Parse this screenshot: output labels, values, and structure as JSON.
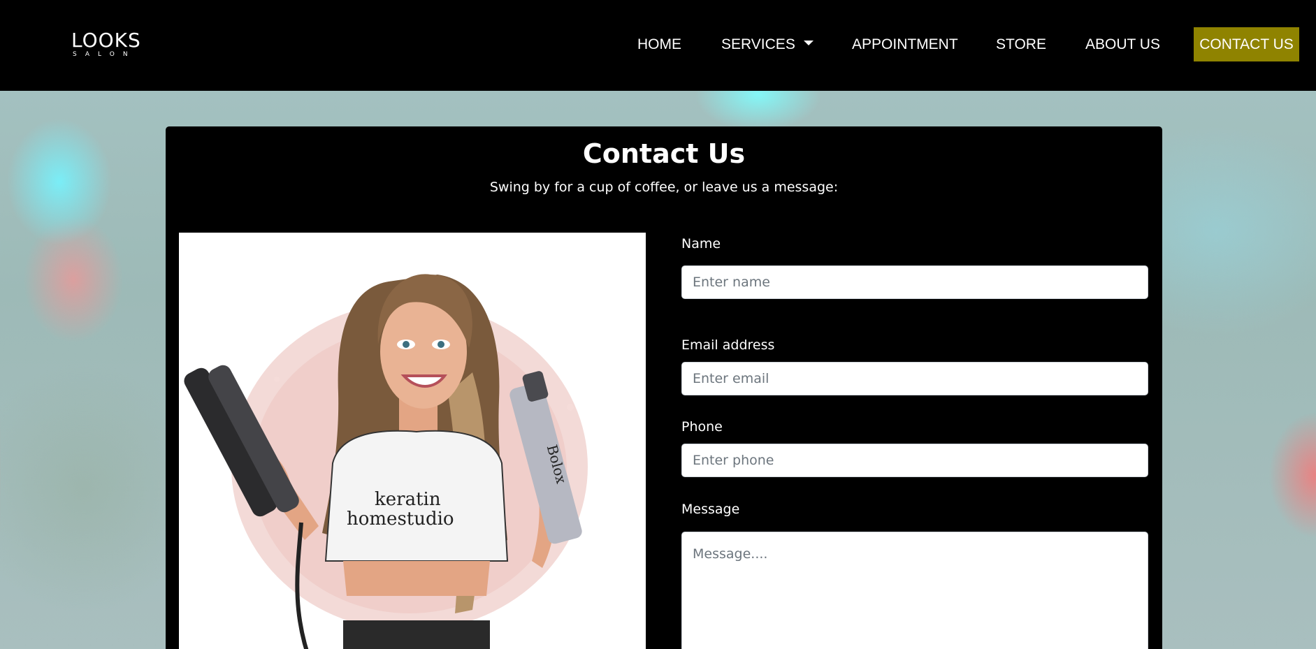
{
  "brand": {
    "name": "LOOKS",
    "tagline": "SALON"
  },
  "nav": {
    "items": [
      {
        "label": "HOME"
      },
      {
        "label": "SERVICES"
      },
      {
        "label": "APPOINTMENT"
      },
      {
        "label": "STORE"
      },
      {
        "label": "ABOUT US"
      }
    ],
    "cta": {
      "label": "CONTACT US",
      "color": "#8f8300"
    }
  },
  "contact": {
    "title": "Contact Us",
    "subtitle": "Swing by for a cup of coffee, or leave us a message:",
    "illustration": {
      "shirt_text": [
        "keratin",
        "homestudio"
      ],
      "bottle_text": "Bolox"
    },
    "form": {
      "name": {
        "label": "Name",
        "placeholder": "Enter name"
      },
      "email": {
        "label": "Email address",
        "placeholder": "Enter email"
      },
      "phone": {
        "label": "Phone",
        "placeholder": "Enter phone"
      },
      "message": {
        "label": "Message",
        "placeholder": "Message...."
      }
    }
  }
}
